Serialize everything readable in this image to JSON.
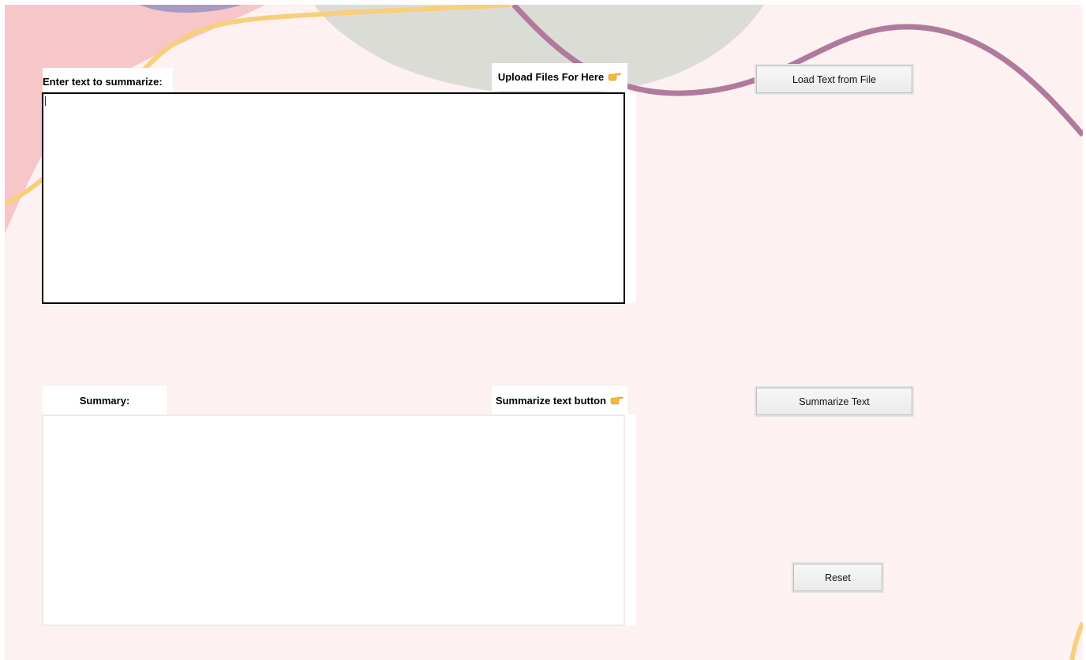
{
  "input_section": {
    "label": "Enter text to summarize:",
    "upload_hint": "Upload Files For Here",
    "text_value": ""
  },
  "summary_section": {
    "label": "Summary:",
    "summarize_hint": "Summarize text button",
    "text_value": ""
  },
  "buttons": {
    "load_label": "Load Text from File",
    "summarize_label": "Summarize Text",
    "reset_label": "Reset"
  },
  "icons": {
    "pointer": "pointing-hand-icon"
  },
  "colors": {
    "background": "#fdf1f2",
    "pink_blob": "#f7c6c8",
    "gray_blob": "#dcdcd7",
    "purple_wave": "#b07a9b",
    "yellow_wave": "#f8cf7a",
    "lavender_blob": "#a79bc3"
  }
}
